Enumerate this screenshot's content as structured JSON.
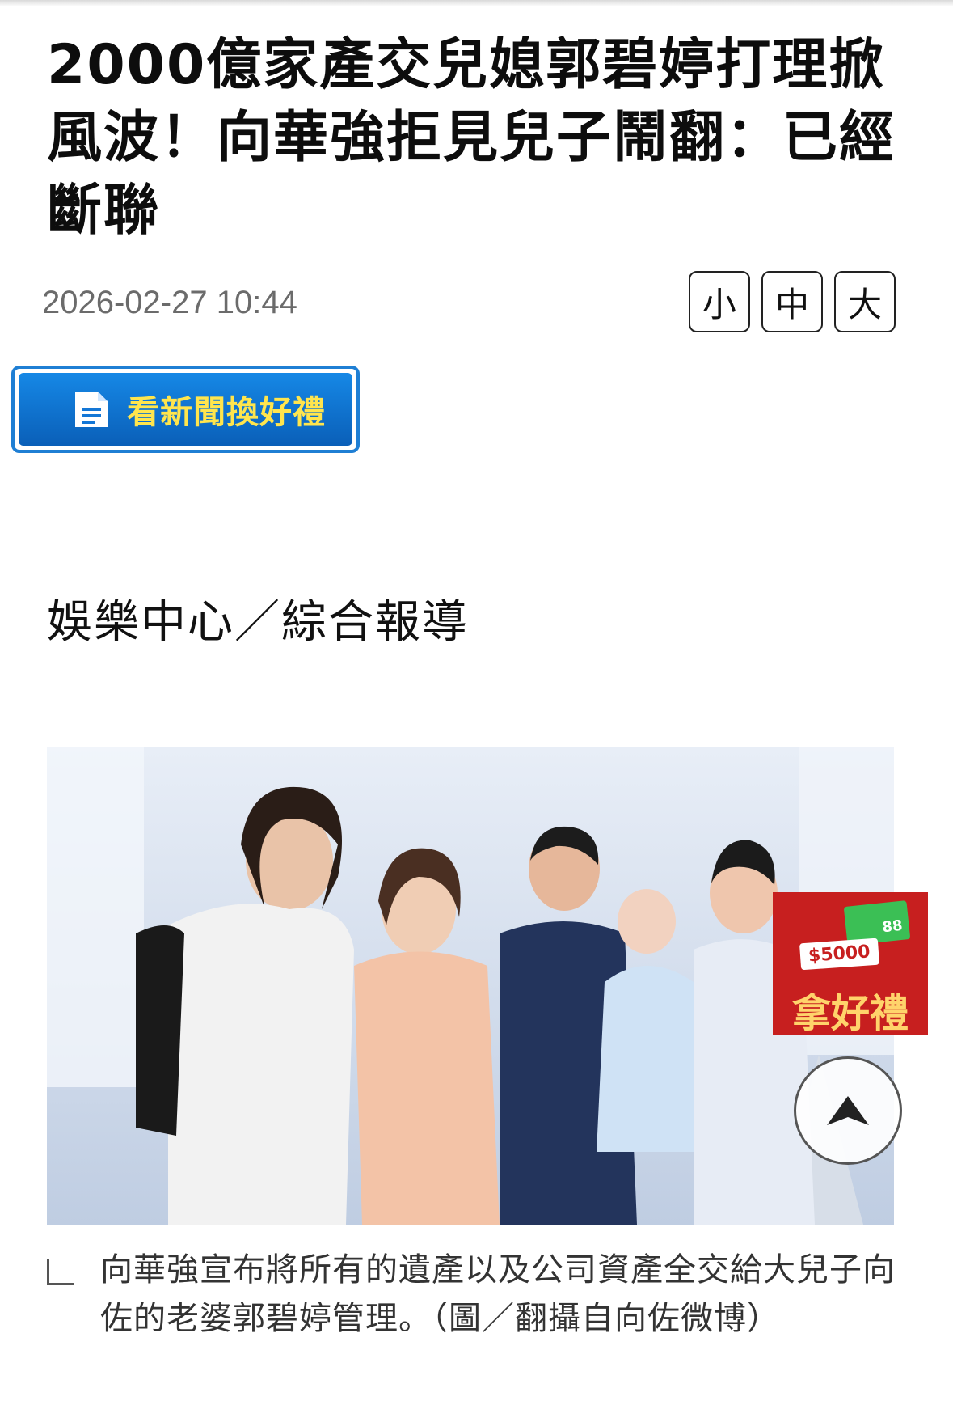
{
  "article": {
    "title": "2000億家產交兒媳郭碧婷打理掀風波！向華強拒見兒子鬧翻：已經斷聯",
    "timestamp": "2026-02-27 10:44",
    "byline": "娛樂中心／綜合報導"
  },
  "font_size": {
    "small": "小",
    "medium": "中",
    "large": "大"
  },
  "promo": {
    "label": "看新聞換好禮"
  },
  "photo": {
    "caption": "向華強宣布將所有的遺產以及公司資產全交給大兒子向佐的老婆郭碧婷管理。（圖／翻攝自向佐微博）"
  },
  "ad": {
    "amount": "$5000",
    "card_text": "88",
    "label": "拿好禮"
  },
  "colors": {
    "promo_blue": "#1688e6",
    "promo_text": "#ffe54d",
    "ad_red": "#c71f1f"
  }
}
